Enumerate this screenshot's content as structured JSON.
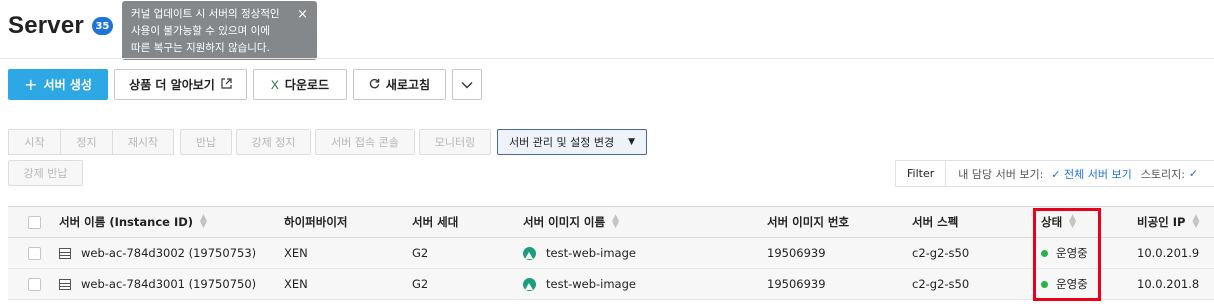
{
  "header": {
    "title": "Server",
    "count_badge": "35"
  },
  "tooltip": {
    "lines": [
      "커널 업데이트 시 서버의 정상적인",
      "사용이 불가능할 수 있으며 이에",
      "따른 복구는 지원하지 않습니다."
    ],
    "close": "×"
  },
  "toolbar": {
    "create_label": "서버 생성",
    "create_icon": "+",
    "learn_more_label": "상품 더 알아보기",
    "download_label": "다운로드",
    "refresh_label": "새로고침",
    "more_icon": "chevron-down-icon"
  },
  "actions": {
    "start": "시작",
    "stop": "정지",
    "restart": "재시작",
    "return": "반납",
    "force_stop": "강제 정지",
    "console": "서버 접속 콘솔",
    "monitoring": "모니터링",
    "manage_label": "서버 관리 및 설정 변경",
    "force_return": "강제 반납"
  },
  "filter": {
    "filter_label": "Filter",
    "my_servers_label": "내 담당 서버 보기:",
    "all_servers_label": "전체 서버 보기",
    "storage_label": "스토리지:"
  },
  "table": {
    "headers": {
      "name": "서버 이름 (Instance ID)",
      "hypervisor": "하이퍼바이저",
      "generation": "서버 세대",
      "image_name": "서버 이미지 이름",
      "image_no": "서버 이미지 번호",
      "spec": "서버 스펙",
      "status": "상태",
      "private_ip": "비공인 IP"
    },
    "rows": [
      {
        "name": "web-ac-784d3002 (19750753)",
        "hypervisor": "XEN",
        "generation": "G2",
        "image_name": "test-web-image",
        "image_no": "19506939",
        "spec": "c2-g2-s50",
        "status": "운영중",
        "private_ip": "10.0.201.9"
      },
      {
        "name": "web-ac-784d3001 (19750750)",
        "hypervisor": "XEN",
        "generation": "G2",
        "image_name": "test-web-image",
        "image_no": "19506939",
        "spec": "c2-g2-s50",
        "status": "운영중",
        "private_ip": "10.0.201.8"
      }
    ]
  },
  "colors": {
    "primary": "#2ea8e5",
    "badge": "#1f75d6",
    "status_running": "#2bb24c",
    "highlight": "#e8001c"
  }
}
